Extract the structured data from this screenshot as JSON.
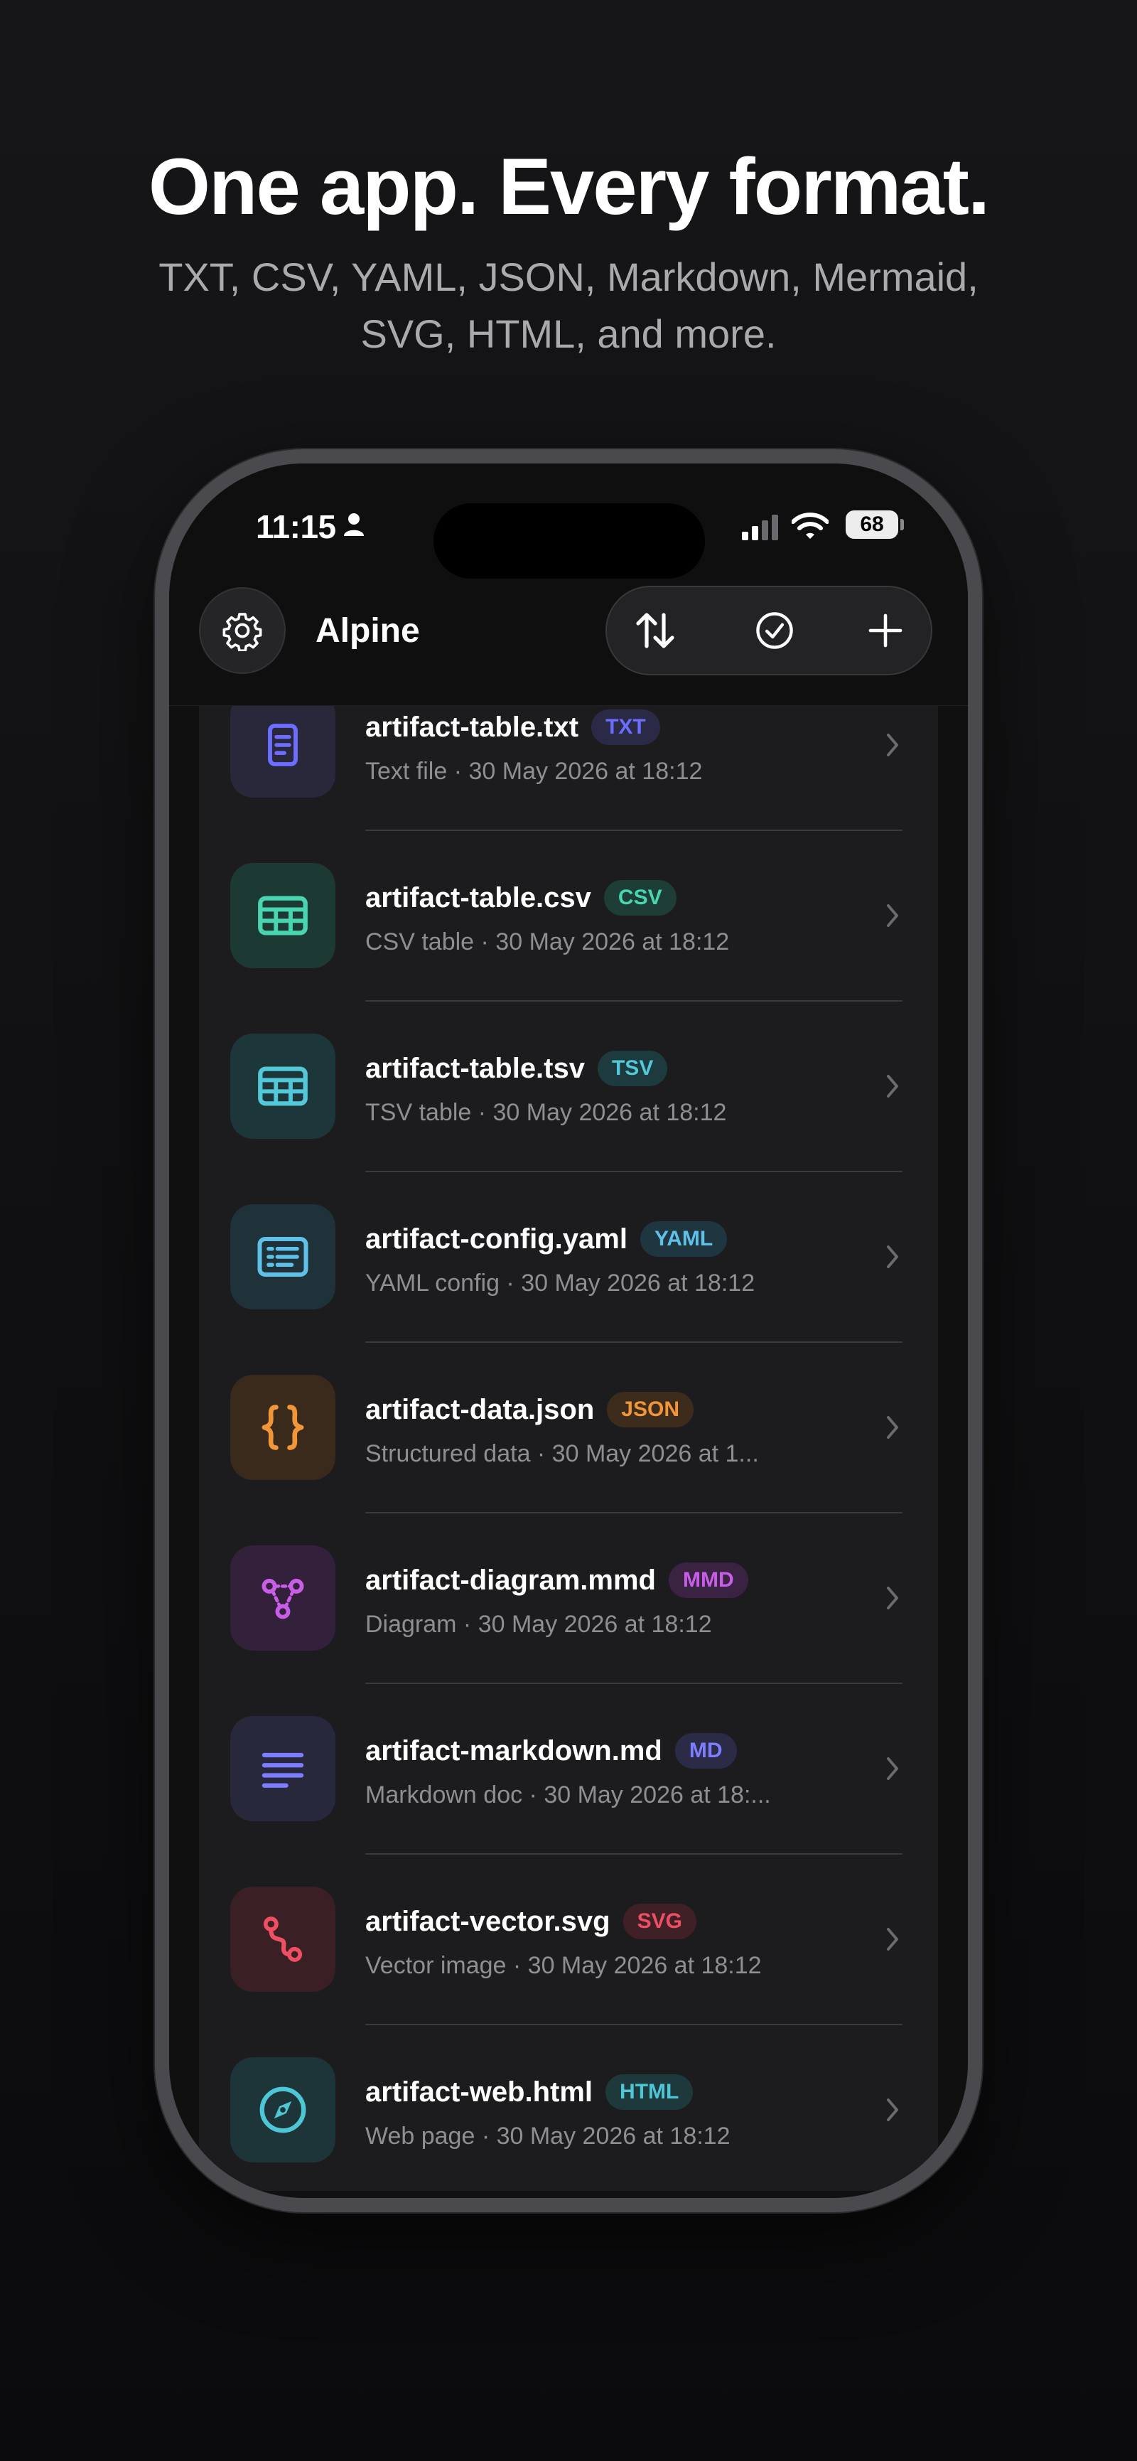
{
  "hero": {
    "headline": "One app. Every format.",
    "subline": "TXT, CSV, YAML, JSON, Markdown, Mermaid, SVG, HTML, and more."
  },
  "status_bar": {
    "time": "11:15",
    "battery": "68"
  },
  "header": {
    "title": "Alpine",
    "icons": [
      "gear-icon",
      "sort-icon",
      "select-check-icon",
      "plus-icon"
    ]
  },
  "files": [
    {
      "name": "artifact-table.txt",
      "badge": "TXT",
      "subtitle": "Text file · 30 May 2026 at 18:12",
      "icon": "document-icon",
      "icon_bg": "#28283a",
      "accent": "#6d6dff",
      "badge_bg": "#2a2a46"
    },
    {
      "name": "artifact-table.csv",
      "badge": "CSV",
      "subtitle": "CSV table · 30 May 2026 at 18:12",
      "icon": "table-icon",
      "icon_bg": "#1c3a33",
      "accent": "#47d6b0",
      "badge_bg": "#1d3d36"
    },
    {
      "name": "artifact-table.tsv",
      "badge": "TSV",
      "subtitle": "TSV table · 30 May 2026 at 18:12",
      "icon": "table-icon",
      "icon_bg": "#1d3639",
      "accent": "#52c8d8",
      "badge_bg": "#1d3a3e"
    },
    {
      "name": "artifact-config.yaml",
      "badge": "YAML",
      "subtitle": "YAML config · 30 May 2026 at 18:12",
      "icon": "config-list-icon",
      "icon_bg": "#1f3139",
      "accent": "#5fc0e8",
      "badge_bg": "#1f3640"
    },
    {
      "name": "artifact-data.json",
      "badge": "JSON",
      "subtitle": "Structured data · 30 May 2026 at 1...",
      "icon": "braces-icon",
      "icon_bg": "#3a2a1c",
      "accent": "#f0953a",
      "badge_bg": "#3d2c1c"
    },
    {
      "name": "artifact-diagram.mmd",
      "badge": "MMD",
      "subtitle": "Diagram · 30 May 2026 at 18:12",
      "icon": "diagram-nodes-icon",
      "icon_bg": "#33203a",
      "accent": "#c85ee8",
      "badge_bg": "#3a2342"
    },
    {
      "name": "artifact-markdown.md",
      "badge": "MD",
      "subtitle": "Markdown doc · 30 May 2026 at 18:...",
      "icon": "text-lines-icon",
      "icon_bg": "#28283c",
      "accent": "#7d7dff",
      "badge_bg": "#2b2b48"
    },
    {
      "name": "artifact-vector.svg",
      "badge": "SVG",
      "subtitle": "Vector image · 30 May 2026 at 18:12",
      "icon": "bezier-path-icon",
      "icon_bg": "#3a1f24",
      "accent": "#ee4f63",
      "badge_bg": "#3f2026"
    },
    {
      "name": "artifact-web.html",
      "badge": "HTML",
      "subtitle": "Web page · 30 May 2026 at 18:12",
      "icon": "compass-icon",
      "icon_bg": "#1d3538",
      "accent": "#4ec6d6",
      "badge_bg": "#1e393c"
    }
  ]
}
